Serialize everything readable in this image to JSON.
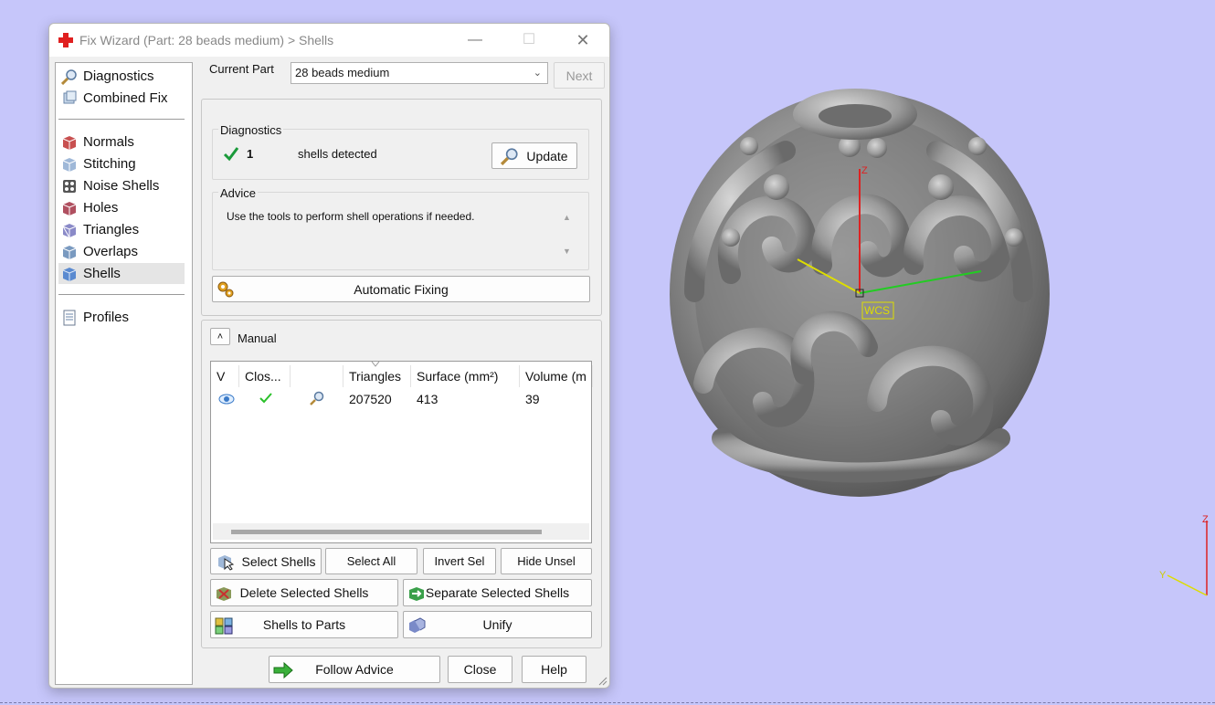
{
  "window": {
    "title": "Fix Wizard (Part: 28 beads medium) > Shells",
    "minimize": "—",
    "maximize": "☐",
    "close": "✕"
  },
  "nav": {
    "items": [
      {
        "label": "Diagnostics",
        "icon": "magnifier-icon"
      },
      {
        "label": "Combined Fix",
        "icon": "combined-fix-icon"
      },
      {
        "label": "Normals",
        "icon": "normals-cube-icon"
      },
      {
        "label": "Stitching",
        "icon": "stitching-cube-icon"
      },
      {
        "label": "Noise Shells",
        "icon": "noise-shells-icon"
      },
      {
        "label": "Holes",
        "icon": "holes-cube-icon"
      },
      {
        "label": "Triangles",
        "icon": "triangles-cube-icon"
      },
      {
        "label": "Overlaps",
        "icon": "overlaps-cube-icon"
      },
      {
        "label": "Shells",
        "icon": "shells-cube-icon"
      },
      {
        "label": "Profiles",
        "icon": "profile-page-icon"
      }
    ],
    "selected": "Shells"
  },
  "part": {
    "label": "Current Part",
    "value": "28 beads medium",
    "next": "Next"
  },
  "diagnostics": {
    "title": "Diagnostics",
    "count": "1",
    "text": "shells detected",
    "update": "Update"
  },
  "advice": {
    "title": "Advice",
    "text": "Use the tools to perform shell operations if needed."
  },
  "auto_fix": "Automatic Fixing",
  "manual": {
    "label": "Manual",
    "columns": [
      "V",
      "Clos...",
      "",
      "Triangles",
      "Surface (mm²)",
      "Volume (m"
    ],
    "rows": [
      {
        "triangles": "207520",
        "surface": "413",
        "volume": "39"
      }
    ]
  },
  "buttons": {
    "select_shells": "Select Shells",
    "select_all": "Select All",
    "invert_sel": "Invert Sel",
    "hide_unsel": "Hide Unsel",
    "delete_selected": "Delete Selected Shells",
    "separate_selected": "Separate Selected Shells",
    "shells_to_parts": "Shells to Parts",
    "unify": "Unify",
    "follow_advice": "Follow Advice",
    "close": "Close",
    "help": "Help"
  },
  "viewport": {
    "wcs_label": "WCS",
    "axis_z": "Z",
    "axis_y": "Y",
    "colors": {
      "background": "#c6c6fa",
      "model": "#8e8e8e",
      "x_axis": "#22cc22",
      "y_axis": "#dddd00",
      "z_axis": "#dd2222"
    }
  }
}
